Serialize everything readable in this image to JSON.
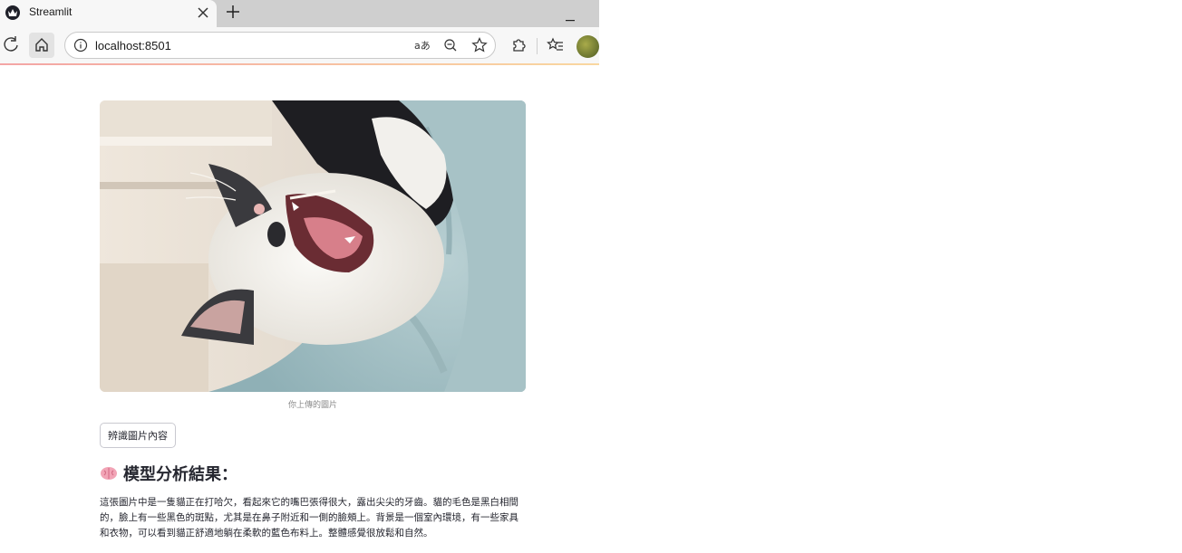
{
  "browser": {
    "tab": {
      "title": "Streamlit",
      "favicon": "streamlit-crown-icon"
    },
    "address_bar": {
      "url": "localhost:8501"
    },
    "icons": {
      "reload": "reload-icon",
      "home": "home-icon",
      "site_info": "info-icon",
      "read_aloud": "read-aloud-icon",
      "zoom_out": "zoom-out-icon",
      "favorite": "star-icon",
      "extensions": "puzzle-icon",
      "favorites_bar": "favorites-icon",
      "profile": "avatar"
    }
  },
  "page": {
    "image_caption": "你上傳的圖片",
    "analyze_button_label": "辨識圖片內容",
    "result_heading": "模型分析結果：",
    "result_heading_icon": "brain-icon",
    "result_text": "這張圖片中是一隻貓正在打哈欠，看起來它的嘴巴張得很大，露出尖尖的牙齒。貓的毛色是黑白相間的，臉上有一些黑色的斑點，尤其是在鼻子附近和一側的臉頰上。背景是一個室內環境，有一些家具和衣物，可以看到貓正舒適地躺在柔軟的藍色布料上。整體感覺很放鬆和自然。"
  },
  "colors": {
    "text_primary": "#262730",
    "caption": "#8a8a8a",
    "blanket": "#a9c4c8"
  }
}
